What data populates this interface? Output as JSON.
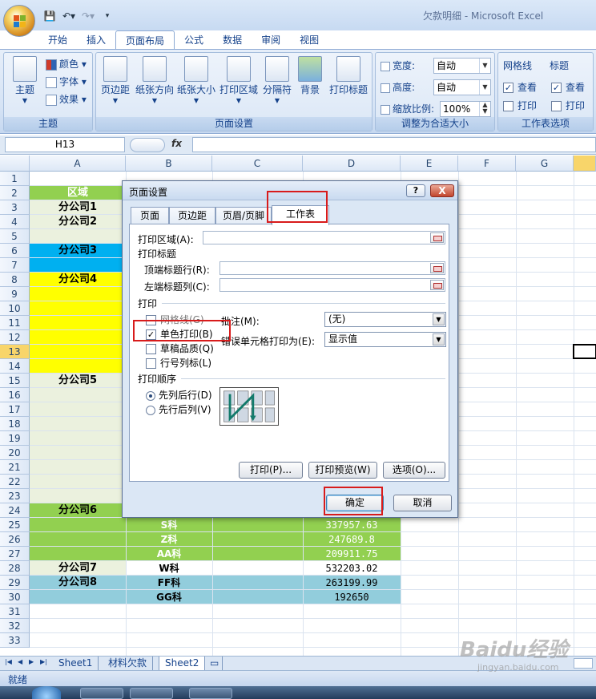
{
  "app": {
    "title": "欠款明细 - Microsoft Excel"
  },
  "ribbon": {
    "tabs": [
      "开始",
      "插入",
      "页面布局",
      "公式",
      "数据",
      "审阅",
      "视图"
    ],
    "theme_group": {
      "label": "主题",
      "theme_btn": "主题",
      "colors": "颜色",
      "fonts": "字体",
      "effects": "效果"
    },
    "page_setup_group": {
      "label": "页面设置",
      "margins": "页边距",
      "orientation": "纸张方向",
      "size": "纸张大小",
      "print_area": "打印区域",
      "breaks": "分隔符",
      "background": "背景",
      "print_titles": "打印标题"
    },
    "scale_group": {
      "label": "调整为合适大小",
      "width_label": "宽度:",
      "width_value": "自动",
      "height_label": "高度:",
      "height_value": "自动",
      "scale_label": "缩放比例:",
      "scale_value": "100%"
    },
    "sheet_options_group": {
      "label": "工作表选项",
      "gridlines": "网格线",
      "headings": "标题",
      "view": "查看",
      "print": "打印"
    }
  },
  "formula_bar": {
    "name_box": "H13",
    "fx": "fx"
  },
  "columns": [
    "A",
    "B",
    "C",
    "D",
    "E",
    "F",
    "G"
  ],
  "rows": [
    "1",
    "2",
    "3",
    "4",
    "5",
    "6",
    "7",
    "8",
    "9",
    "10",
    "11",
    "12",
    "13",
    "14",
    "15",
    "16",
    "17",
    "18",
    "19",
    "20",
    "21",
    "22",
    "23",
    "24",
    "25",
    "26",
    "27",
    "28",
    "29",
    "30",
    "31",
    "32",
    "33"
  ],
  "cells": {
    "a2": "区域",
    "a3": "分公司1",
    "a4": "分公司2",
    "a6": "分公司3",
    "a8": "分公司4",
    "a15": "分公司5",
    "a24": "分公司6",
    "b25": "S科",
    "d25": "337957.63",
    "b26": "Z科",
    "d26": "247689.8",
    "b27": "AA科",
    "d27": "209911.75",
    "a28": "分公司7",
    "b28": "W科",
    "d28": "532203.02",
    "a29": "分公司8",
    "b29": "FF科",
    "d29": "263199.99",
    "b30": "GG科",
    "d30": "192650"
  },
  "sheet_tabs": [
    "Sheet1",
    "材料欠款",
    "Sheet2"
  ],
  "status": "就绪",
  "watermark": {
    "main": "Baidu经验",
    "sub": "jingyan.baidu.com"
  },
  "dialog": {
    "title": "页面设置",
    "help": "?",
    "close": "X",
    "tabs": [
      "页面",
      "页边距",
      "页眉/页脚",
      "工作表"
    ],
    "print_area_label": "打印区域(A):",
    "print_titles_label": "打印标题",
    "top_rows_label": "顶端标题行(R):",
    "left_cols_label": "左端标题列(C):",
    "print_section": "打印",
    "gridlines": "网格线(G)",
    "mono": "单色打印(B)",
    "draft": "草稿品质(Q)",
    "headings": "行号列标(L)",
    "comments_label": "批注(M):",
    "comments_value": "(无)",
    "errors_label": "错误单元格打印为(E):",
    "errors_value": "显示值",
    "order_section": "打印顺序",
    "order_down": "先列后行(D)",
    "order_over": "先行后列(V)",
    "print_btn": "打印(P)...",
    "preview_btn": "打印预览(W)",
    "options_btn": "选项(O)...",
    "ok_btn": "确定",
    "cancel_btn": "取消"
  }
}
